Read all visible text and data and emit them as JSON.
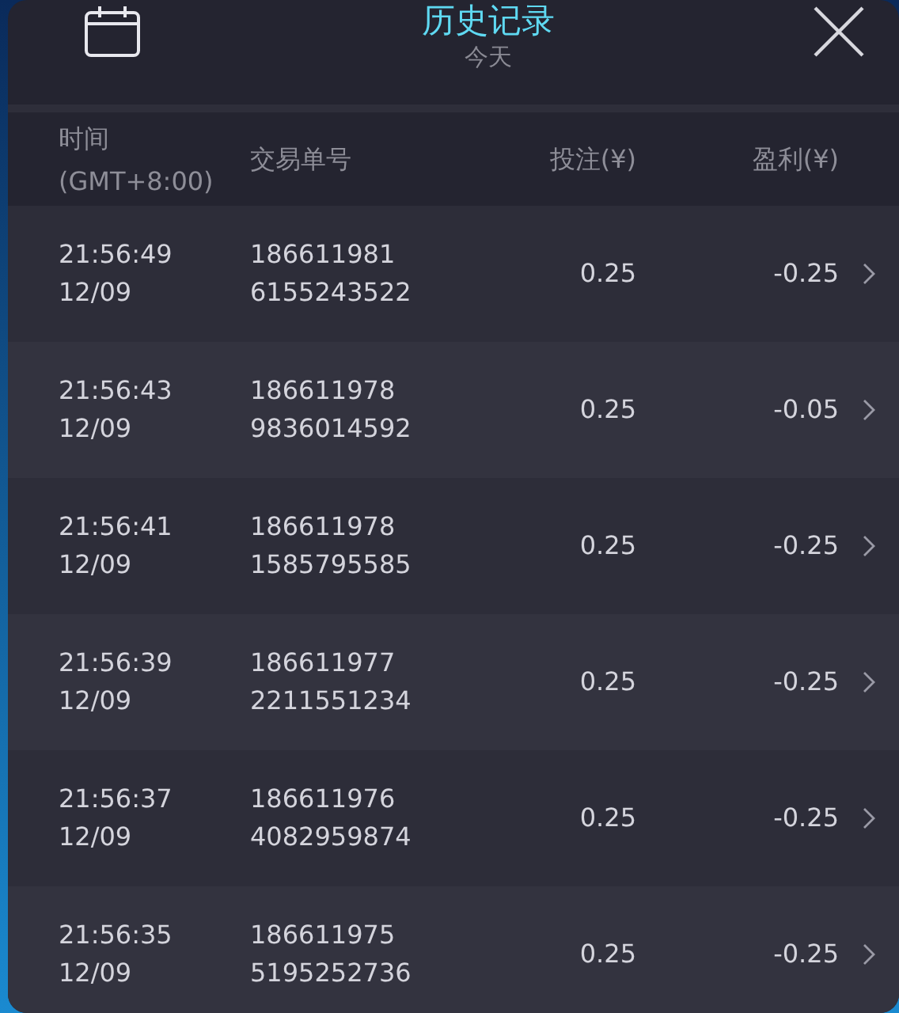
{
  "header": {
    "title": "历史记录",
    "subtitle": "今天"
  },
  "table": {
    "columns": [
      {
        "kind": "time",
        "label": "时间",
        "sublabel": "(GMT+8:00)"
      },
      {
        "kind": "order",
        "label": "交易单号"
      },
      {
        "kind": "bet",
        "label": "投注(¥)"
      },
      {
        "kind": "profit",
        "label": "盈利(¥)"
      }
    ],
    "rows": [
      {
        "time": "21:56:49",
        "date": "12/09",
        "order_no": [
          "186611981",
          "6155243522"
        ],
        "bet": "0.25",
        "profit": "-0.25"
      },
      {
        "time": "21:56:43",
        "date": "12/09",
        "order_no": [
          "186611978",
          "9836014592"
        ],
        "bet": "0.25",
        "profit": "-0.05"
      },
      {
        "time": "21:56:41",
        "date": "12/09",
        "order_no": [
          "186611978",
          "1585795585"
        ],
        "bet": "0.25",
        "profit": "-0.25"
      },
      {
        "time": "21:56:39",
        "date": "12/09",
        "order_no": [
          "186611977",
          "2211551234"
        ],
        "bet": "0.25",
        "profit": "-0.25"
      },
      {
        "time": "21:56:37",
        "date": "12/09",
        "order_no": [
          "186611976",
          "4082959874"
        ],
        "bet": "0.25",
        "profit": "-0.25"
      },
      {
        "time": "21:56:35",
        "date": "12/09",
        "order_no": [
          "186611975",
          "5195252736"
        ],
        "bet": "0.25",
        "profit": "-0.25"
      }
    ]
  }
}
